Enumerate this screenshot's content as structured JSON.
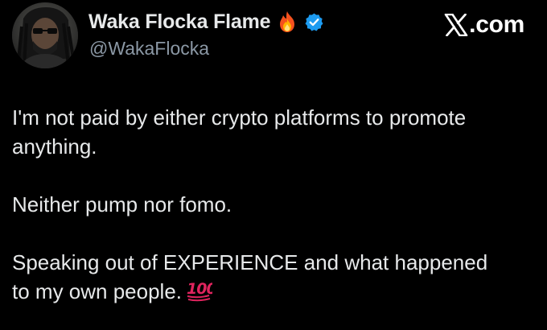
{
  "author": {
    "display_name": "Waka Flocka Flame",
    "handle": "@WakaFlocka",
    "avatar_icon": "user-avatar",
    "name_emoji": "fire-icon",
    "verified_icon": "verified-badge-icon",
    "verified_color": "#1d9bf0"
  },
  "brand": {
    "label": ".com",
    "logo_icon": "x-logo-icon"
  },
  "tweet": {
    "lines": [
      "I'm not paid by either crypto platforms to promote anything.",
      "Neither pump nor fomo.",
      "Speaking out of EXPERIENCE and what happened to my own people."
    ],
    "trailing_emoji": "hundred-points-icon",
    "trailing_emoji_color": "#e0245e"
  },
  "colors": {
    "background": "#000000",
    "text": "#e7e9ea",
    "secondary_text": "#8b98a5"
  }
}
